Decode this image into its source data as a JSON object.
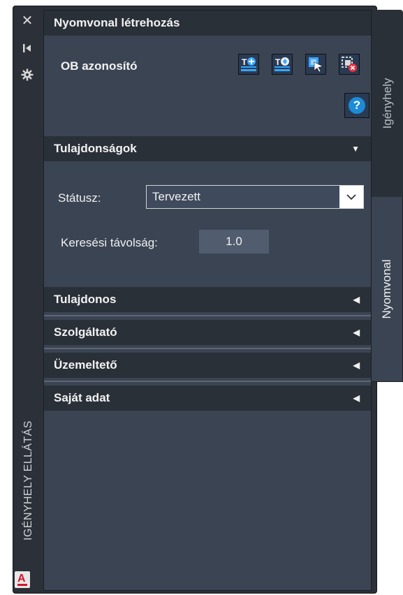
{
  "strip": {
    "close_glyph": "✕",
    "pin_glyph": "⇤",
    "settings_glyph": "✲",
    "vertical_title": "IGÉNYHELY ELLÁTÁS",
    "logo_letter": "A"
  },
  "panel": {
    "header_title": "Nyomvonal létrehozás",
    "ob_label": "OB azonosító",
    "toolbar_icons": [
      "text-add-icon",
      "text-settings-icon",
      "select-pointer-icon",
      "delete-selection-icon",
      "help-icon"
    ],
    "help_glyph": "?"
  },
  "properties": {
    "section_title": "Tulajdonságok",
    "status_label": "Státusz:",
    "status_value": "Tervezett",
    "distance_label": "Keresési távolság:",
    "distance_value": "1.0"
  },
  "collapsed_sections": [
    {
      "title": "Tulajdonos"
    },
    {
      "title": "Szolgáltató"
    },
    {
      "title": "Üzemeltető"
    },
    {
      "title": "Saját adat"
    }
  ],
  "side_tabs": [
    {
      "label": "Igényhely",
      "active": false
    },
    {
      "label": "Nyomvonal",
      "active": true
    }
  ],
  "colors": {
    "panel_bg": "#3b4453",
    "header_bg": "#2a3038",
    "help_blue": "#1c8bd8",
    "delete_red": "#e8313f"
  }
}
